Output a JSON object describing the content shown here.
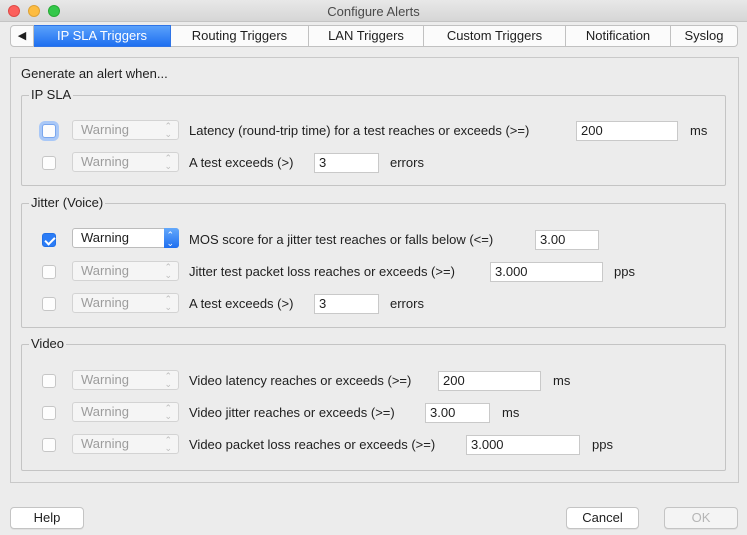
{
  "window": {
    "title": "Configure Alerts"
  },
  "tabs": [
    {
      "label": "◀"
    },
    {
      "label": "IP SLA Triggers"
    },
    {
      "label": "Routing Triggers"
    },
    {
      "label": "LAN Triggers"
    },
    {
      "label": "Custom Triggers"
    },
    {
      "label": "Notification"
    },
    {
      "label": "Syslog"
    }
  ],
  "intro": "Generate an alert when...",
  "ip_sla": {
    "title": "IP SLA",
    "rows": [
      {
        "severity": "Warning",
        "label": "Latency (round-trip time) for a test reaches or exceeds (>=)",
        "value": "200",
        "unit": "ms",
        "checked": false
      },
      {
        "severity": "Warning",
        "label": "A test exceeds (>)",
        "value": "3",
        "unit": "errors",
        "checked": false
      }
    ]
  },
  "jitter": {
    "title": "Jitter (Voice)",
    "rows": [
      {
        "severity": "Warning",
        "label": "MOS score for a jitter test reaches or falls below (<=)",
        "value": "3.00",
        "unit": "",
        "checked": true
      },
      {
        "severity": "Warning",
        "label": "Jitter test packet loss reaches or exceeds (>=)",
        "value": "3.000",
        "unit": "pps",
        "checked": false
      },
      {
        "severity": "Warning",
        "label": "A test exceeds (>)",
        "value": "3",
        "unit": "errors",
        "checked": false
      }
    ]
  },
  "video": {
    "title": "Video",
    "rows": [
      {
        "severity": "Warning",
        "label": "Video latency reaches or exceeds (>=)",
        "value": "200",
        "unit": "ms",
        "checked": false
      },
      {
        "severity": "Warning",
        "label": "Video jitter reaches or exceeds (>=)",
        "value": "3.00",
        "unit": "ms",
        "checked": false
      },
      {
        "severity": "Warning",
        "label": "Video packet loss reaches or exceeds (>=)",
        "value": "3.000",
        "unit": "pps",
        "checked": false
      }
    ]
  },
  "buttons": {
    "help": "Help",
    "cancel": "Cancel",
    "ok": "OK"
  },
  "colors": {
    "accent": "#1e6ff0",
    "window_bg": "#ececec"
  },
  "icons": {
    "chevron": "⌃⌄",
    "back": "◀"
  }
}
